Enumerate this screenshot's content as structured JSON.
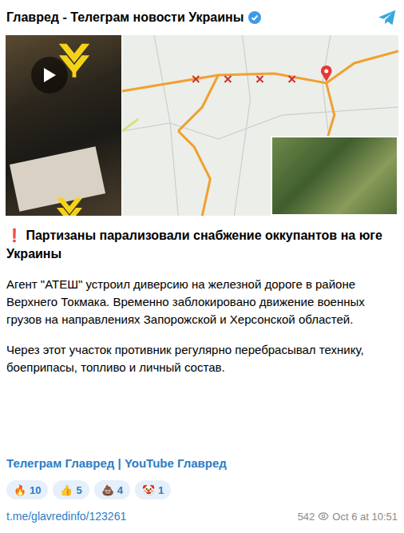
{
  "channel": {
    "name": "Главред - Телеграм новости Украины",
    "verified": true
  },
  "media": {
    "has_video": true
  },
  "post": {
    "title_mark": "❗",
    "title": "Партизаны парализовали снабжение оккупантов на юге Украины",
    "paragraphs": [
      "Агент \"АТЕШ\" устроил диверсию на железной дороге в районе Верхнего Токмака. Временно заблокировано движение военных грузов на направлениях Запорожской и Херсонской областей.",
      "Через этот участок противник регулярно перебрасывал технику, боеприпасы, топливо и личный состав."
    ],
    "links": [
      "Телеграм Главред",
      "YouTube Главред"
    ],
    "link_separator": " | "
  },
  "reactions": [
    {
      "emoji": "🔥",
      "count": "10"
    },
    {
      "emoji": "👍",
      "count": "5"
    },
    {
      "emoji": "💩",
      "count": "4"
    },
    {
      "emoji": "🤡",
      "count": "1"
    }
  ],
  "footer": {
    "url": "t.me/glavredinfo/123261",
    "views": "542",
    "date": "Oct 6 at 10:51"
  }
}
